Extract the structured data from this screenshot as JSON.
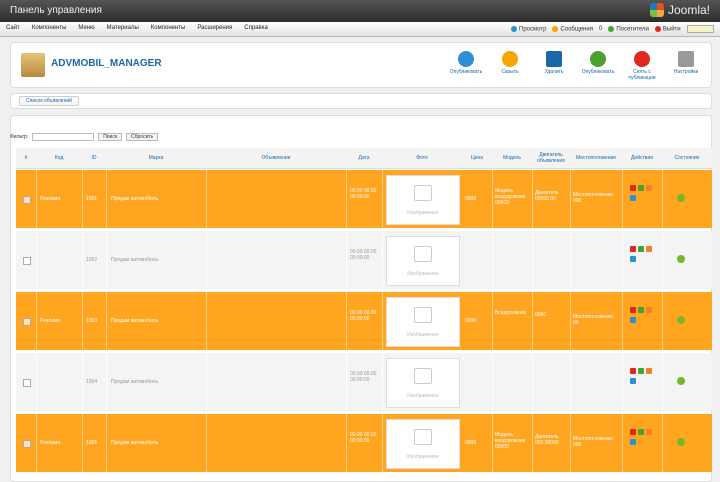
{
  "window": {
    "title": "Панель управления",
    "brand": "Joomla!"
  },
  "menu": [
    "Сайт",
    "Компоненты",
    "Меню",
    "Материалы",
    "Компоненты",
    "Расширения",
    "Справка"
  ],
  "status": [
    "Просмотр",
    "Сообщения",
    "0",
    "Посетители",
    "Выйти"
  ],
  "toolbar": {
    "title": "ADVMOBIL_MANAGER",
    "buttons": [
      {
        "label": "Опубликовать",
        "color": "#2d8fd5"
      },
      {
        "label": "Скрыть",
        "color": "#f7a600"
      },
      {
        "label": "Удалить",
        "color": "#1c67a8"
      },
      {
        "label": "Опубликовать",
        "color": "#4aa12d"
      },
      {
        "label": "Снять с публикации",
        "color": "#e0261d"
      },
      {
        "label": "Настройки",
        "color": "#999999"
      }
    ]
  },
  "subtab": "Список объявлений",
  "filter": {
    "label": "Фильтр:",
    "go": "Поиск",
    "reset": "Сбросить"
  },
  "columns": [
    "#",
    "Код",
    "ID",
    "Марка",
    "Объявление",
    "Дата",
    "Фото",
    "Цена",
    "Модель",
    "Двигатель объявления",
    "Местоположение",
    "Действия",
    "Состояние"
  ],
  "image_caption": "Изображение",
  "rows": [
    {
      "hl": true,
      "code": "Реклама",
      "id": "1001",
      "title": "Продам автомобиль",
      "date": "00.00 00.00 00:00:00",
      "price": "0000",
      "model": "Модель вседорожник 00000",
      "engine": "Двигатель 00000 00",
      "location": "Местоположение 000"
    },
    {
      "hl": false,
      "code": "",
      "id": "1002",
      "title": "Продам автомобиль",
      "date": "00.00 00.00 00:00:00",
      "price": "",
      "model": "",
      "engine": "",
      "location": ""
    },
    {
      "hl": true,
      "code": "Реклама",
      "id": "1003",
      "title": "Продам автомобиль",
      "date": "00.00 00.00 00:00:00",
      "price": "0000",
      "model": "Вседорожник",
      "engine": "0000",
      "location": "Местоположение 00"
    },
    {
      "hl": false,
      "code": "",
      "id": "1004",
      "title": "Продам автомобиль",
      "date": "00.00 00.00 00:00:00",
      "price": "",
      "model": "",
      "engine": "",
      "location": ""
    },
    {
      "hl": true,
      "code": "Реклама",
      "id": "1005",
      "title": "Продам автомобиль",
      "date": "00.00 00.00 00:00:00",
      "price": "0000",
      "model": "Модель вседорожник 00000",
      "engine": "Двигатель 000 00000",
      "location": "Местоположение 000"
    }
  ]
}
